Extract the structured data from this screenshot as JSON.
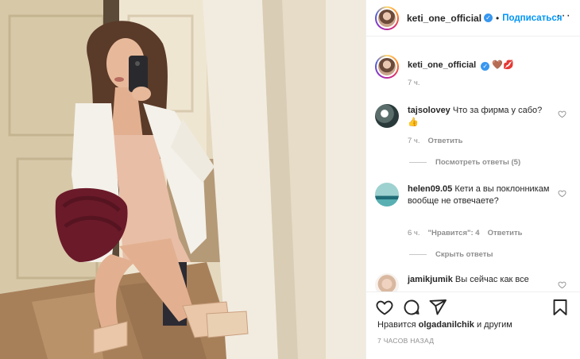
{
  "header": {
    "username": "keti_one_official",
    "separator": "•",
    "follow_label": "Подписаться",
    "more_icon": "more-horizontal-icon"
  },
  "caption": {
    "username": "keti_one_official",
    "text": "🤎💋",
    "time": "7 ч."
  },
  "comments": [
    {
      "username": "tajsolovey",
      "text": "Что за фирма у сабо?",
      "emoji": "👍",
      "time": "7 ч.",
      "reply_label": "Ответить",
      "replies_toggle": "Посмотреть ответы (5)"
    },
    {
      "username": "helen09.05",
      "text": "Кети а вы поклонникам вообще не отвечаете?",
      "time": "6 ч.",
      "likes_label": "\"Нравится\": 4",
      "reply_label": "Ответить",
      "replies_toggle": "Скрыть ответы"
    },
    {
      "username": "jamikjumik",
      "text": "Вы сейчас как все"
    }
  ],
  "actions": {
    "like_icon": "heart-icon",
    "comment_icon": "comment-icon",
    "share_icon": "share-icon",
    "save_icon": "bookmark-icon"
  },
  "likes": {
    "prefix": "Нравится",
    "user": "olgadanilchik",
    "suffix": "и другим"
  },
  "timestamp": "7 ЧАСОВ НАЗАД",
  "colors": {
    "link": "#0095f6",
    "verified": "#3897f0",
    "muted": "#8e8e8e",
    "text": "#262626"
  }
}
